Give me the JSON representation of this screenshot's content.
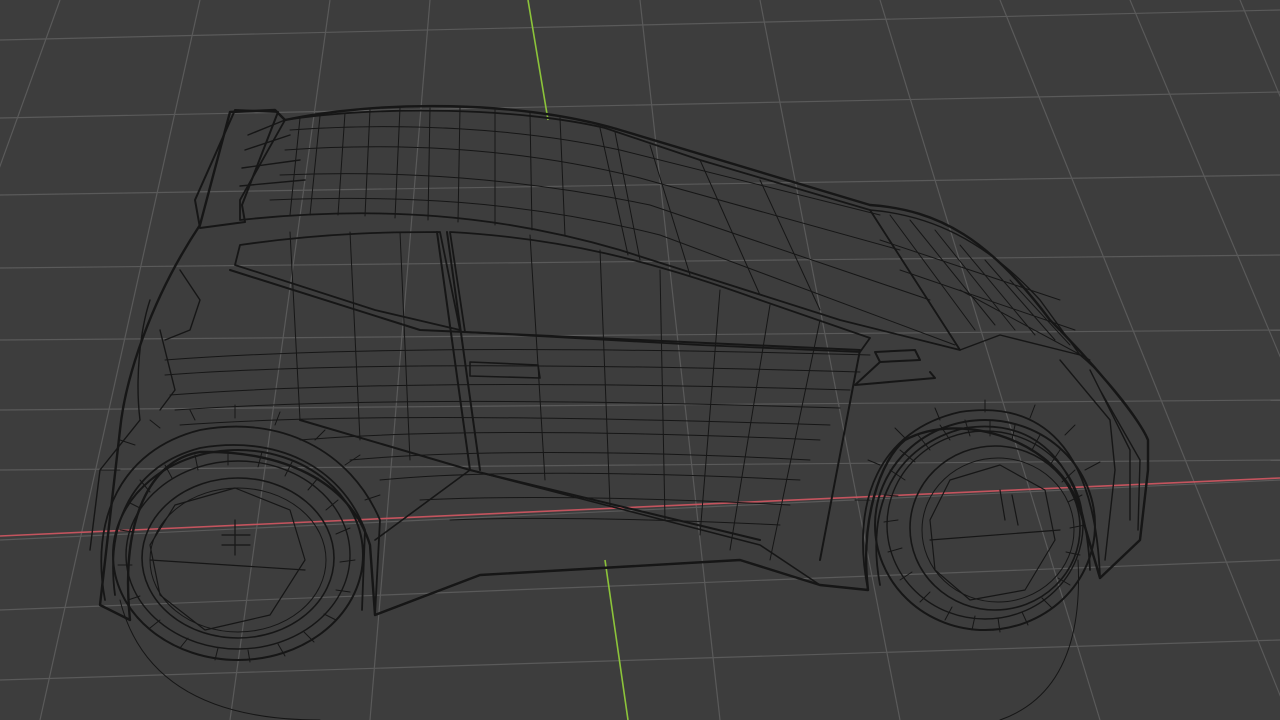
{
  "viewport": {
    "mode": "wireframe",
    "background_color": "#3d3d3d",
    "grid_color": "#5a5a5a",
    "x_axis_color": "#c4545e",
    "y_axis_color": "#8cc43a",
    "wire_color": "#161616"
  },
  "scene": {
    "object": "car-mesh",
    "grid_visible": true,
    "wireframe_overlay": true
  }
}
